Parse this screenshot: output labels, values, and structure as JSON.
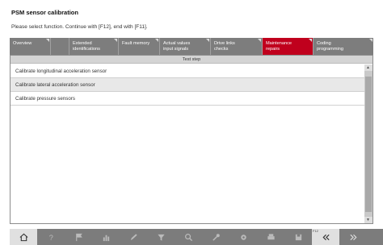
{
  "header": {
    "title": "PSM sensor calibration",
    "instruction": "Please select function. Continue with [F12], end with [F11]."
  },
  "tabs": [
    {
      "line1": "Overview",
      "line2": "",
      "active": false
    },
    {
      "line1": "",
      "line2": "",
      "active": false
    },
    {
      "line1": "Extended",
      "line2": "identifications",
      "active": false
    },
    {
      "line1": "Fault memory",
      "line2": "",
      "active": false
    },
    {
      "line1": "Actual values",
      "line2": "input signals",
      "active": false
    },
    {
      "line1": "Drive links",
      "line2": "checks",
      "active": false
    },
    {
      "line1": "Maintenance",
      "line2": "repairs",
      "active": true
    },
    {
      "line1": "Coding",
      "line2": "programming",
      "active": false
    }
  ],
  "table": {
    "column_header": "Test step",
    "rows": [
      "Calibrate longitudinal acceleration sensor",
      "Calibrate lateral acceleration sensor",
      "Calibrate pressure sensors"
    ],
    "selected_row": 1
  },
  "toolbar": {
    "icons": [
      "home-icon",
      "help-icon",
      "flag-icon",
      "chart-icon",
      "pencil-icon",
      "filter-icon",
      "search-icon",
      "wrench-icon",
      "settings-icon",
      "print-icon",
      "save-icon",
      "back-icon",
      "forward-icon"
    ],
    "f12_label": "F12"
  },
  "colors": {
    "active_tab": "#c0001d",
    "tab_bar": "#7d7d7d",
    "toolbar": "#7c7c7c"
  }
}
